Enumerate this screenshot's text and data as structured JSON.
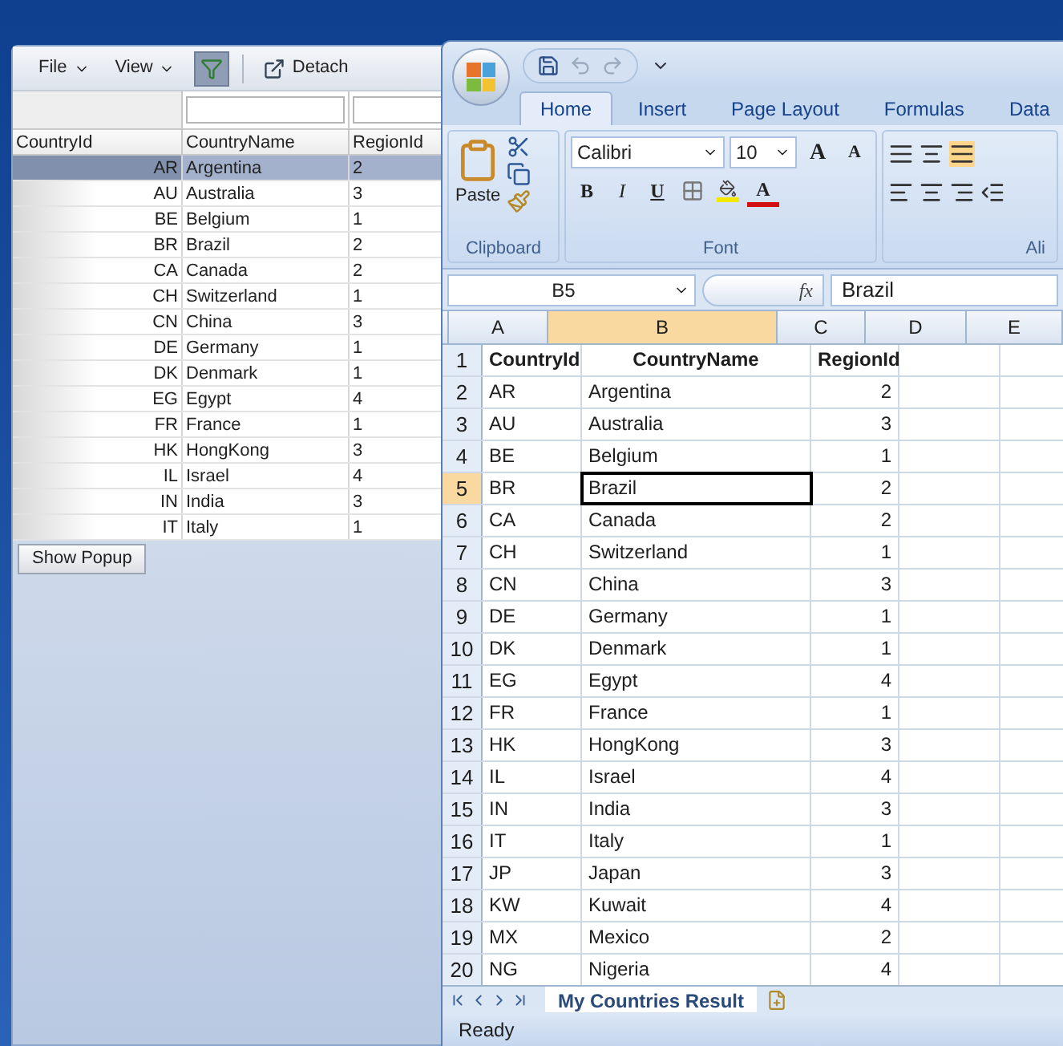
{
  "left_panel": {
    "menus": [
      {
        "label": "File"
      },
      {
        "label": "View"
      }
    ],
    "filter_button": {
      "on": true
    },
    "detach_button": {
      "label": "Detach"
    },
    "table": {
      "columns": [
        "CountryId",
        "CountryName",
        "RegionId"
      ],
      "rows": [
        {
          "cells": [
            "AR",
            "Argentina",
            "2"
          ],
          "selected": true
        },
        {
          "cells": [
            "AU",
            "Australia",
            "3"
          ],
          "selected": false
        },
        {
          "cells": [
            "BE",
            "Belgium",
            "1"
          ],
          "selected": false
        },
        {
          "cells": [
            "BR",
            "Brazil",
            "2"
          ],
          "selected": false
        },
        {
          "cells": [
            "CA",
            "Canada",
            "2"
          ],
          "selected": false
        },
        {
          "cells": [
            "CH",
            "Switzerland",
            "1"
          ],
          "selected": false
        },
        {
          "cells": [
            "CN",
            "China",
            "3"
          ],
          "selected": false
        },
        {
          "cells": [
            "DE",
            "Germany",
            "1"
          ],
          "selected": false
        },
        {
          "cells": [
            "DK",
            "Denmark",
            "1"
          ],
          "selected": false
        },
        {
          "cells": [
            "EG",
            "Egypt",
            "4"
          ],
          "selected": false
        },
        {
          "cells": [
            "FR",
            "France",
            "1"
          ],
          "selected": false
        },
        {
          "cells": [
            "HK",
            "HongKong",
            "3"
          ],
          "selected": false
        },
        {
          "cells": [
            "IL",
            "Israel",
            "4"
          ],
          "selected": false
        },
        {
          "cells": [
            "IN",
            "India",
            "3"
          ],
          "selected": false
        },
        {
          "cells": [
            "IT",
            "Italy",
            "1"
          ],
          "selected": false
        }
      ]
    },
    "show_popup_button": "Show Popup"
  },
  "excel": {
    "tabs": [
      {
        "label": "Home",
        "selected": true
      },
      {
        "label": "Insert",
        "selected": false
      },
      {
        "label": "Page Layout",
        "selected": false
      },
      {
        "label": "Formulas",
        "selected": false
      },
      {
        "label": "Data",
        "selected": false
      }
    ],
    "clipboard_group": {
      "paste": "Paste",
      "label": "Clipboard"
    },
    "font_group": {
      "font": "Calibri",
      "size": "10",
      "grow": "A",
      "shrink": "A",
      "bold": "B",
      "italic": "I",
      "underline": "U",
      "font_color": "A",
      "label": "Font"
    },
    "alignment_group": {
      "label": "Ali"
    },
    "name_box": "B5",
    "fx": "fx",
    "formula": "Brazil",
    "columns": [
      {
        "label": "A",
        "selected": false
      },
      {
        "label": "B",
        "selected": true
      },
      {
        "label": "C",
        "selected": false
      },
      {
        "label": "D",
        "selected": false
      },
      {
        "label": "E",
        "selected": false
      }
    ],
    "rows": [
      {
        "number": "1",
        "kind": "header",
        "selected": false,
        "cells": [
          "CountryId",
          "CountryName",
          "RegionId"
        ]
      },
      {
        "number": "2",
        "kind": "data",
        "selected": false,
        "cells": [
          "AR",
          "Argentina",
          "2"
        ]
      },
      {
        "number": "3",
        "kind": "data",
        "selected": false,
        "cells": [
          "AU",
          "Australia",
          "3"
        ]
      },
      {
        "number": "4",
        "kind": "data",
        "selected": false,
        "cells": [
          "BE",
          "Belgium",
          "1"
        ]
      },
      {
        "number": "5",
        "kind": "data",
        "selected": true,
        "cells": [
          "BR",
          "Brazil",
          "2"
        ]
      },
      {
        "number": "6",
        "kind": "data",
        "selected": false,
        "cells": [
          "CA",
          "Canada",
          "2"
        ]
      },
      {
        "number": "7",
        "kind": "data",
        "selected": false,
        "cells": [
          "CH",
          "Switzerland",
          "1"
        ]
      },
      {
        "number": "8",
        "kind": "data",
        "selected": false,
        "cells": [
          "CN",
          "China",
          "3"
        ]
      },
      {
        "number": "9",
        "kind": "data",
        "selected": false,
        "cells": [
          "DE",
          "Germany",
          "1"
        ]
      },
      {
        "number": "10",
        "kind": "data",
        "selected": false,
        "cells": [
          "DK",
          "Denmark",
          "1"
        ]
      },
      {
        "number": "11",
        "kind": "data",
        "selected": false,
        "cells": [
          "EG",
          "Egypt",
          "4"
        ]
      },
      {
        "number": "12",
        "kind": "data",
        "selected": false,
        "cells": [
          "FR",
          "France",
          "1"
        ]
      },
      {
        "number": "13",
        "kind": "data",
        "selected": false,
        "cells": [
          "HK",
          "HongKong",
          "3"
        ]
      },
      {
        "number": "14",
        "kind": "data",
        "selected": false,
        "cells": [
          "IL",
          "Israel",
          "4"
        ]
      },
      {
        "number": "15",
        "kind": "data",
        "selected": false,
        "cells": [
          "IN",
          "India",
          "3"
        ]
      },
      {
        "number": "16",
        "kind": "data",
        "selected": false,
        "cells": [
          "IT",
          "Italy",
          "1"
        ]
      },
      {
        "number": "17",
        "kind": "data",
        "selected": false,
        "cells": [
          "JP",
          "Japan",
          "3"
        ]
      },
      {
        "number": "18",
        "kind": "data",
        "selected": false,
        "cells": [
          "KW",
          "Kuwait",
          "4"
        ]
      },
      {
        "number": "19",
        "kind": "data",
        "selected": false,
        "cells": [
          "MX",
          "Mexico",
          "2"
        ]
      },
      {
        "number": "20",
        "kind": "data",
        "selected": false,
        "cells": [
          "NG",
          "Nigeria",
          "4"
        ]
      }
    ],
    "sheet_tab": "My Countries Result",
    "status": "Ready"
  }
}
